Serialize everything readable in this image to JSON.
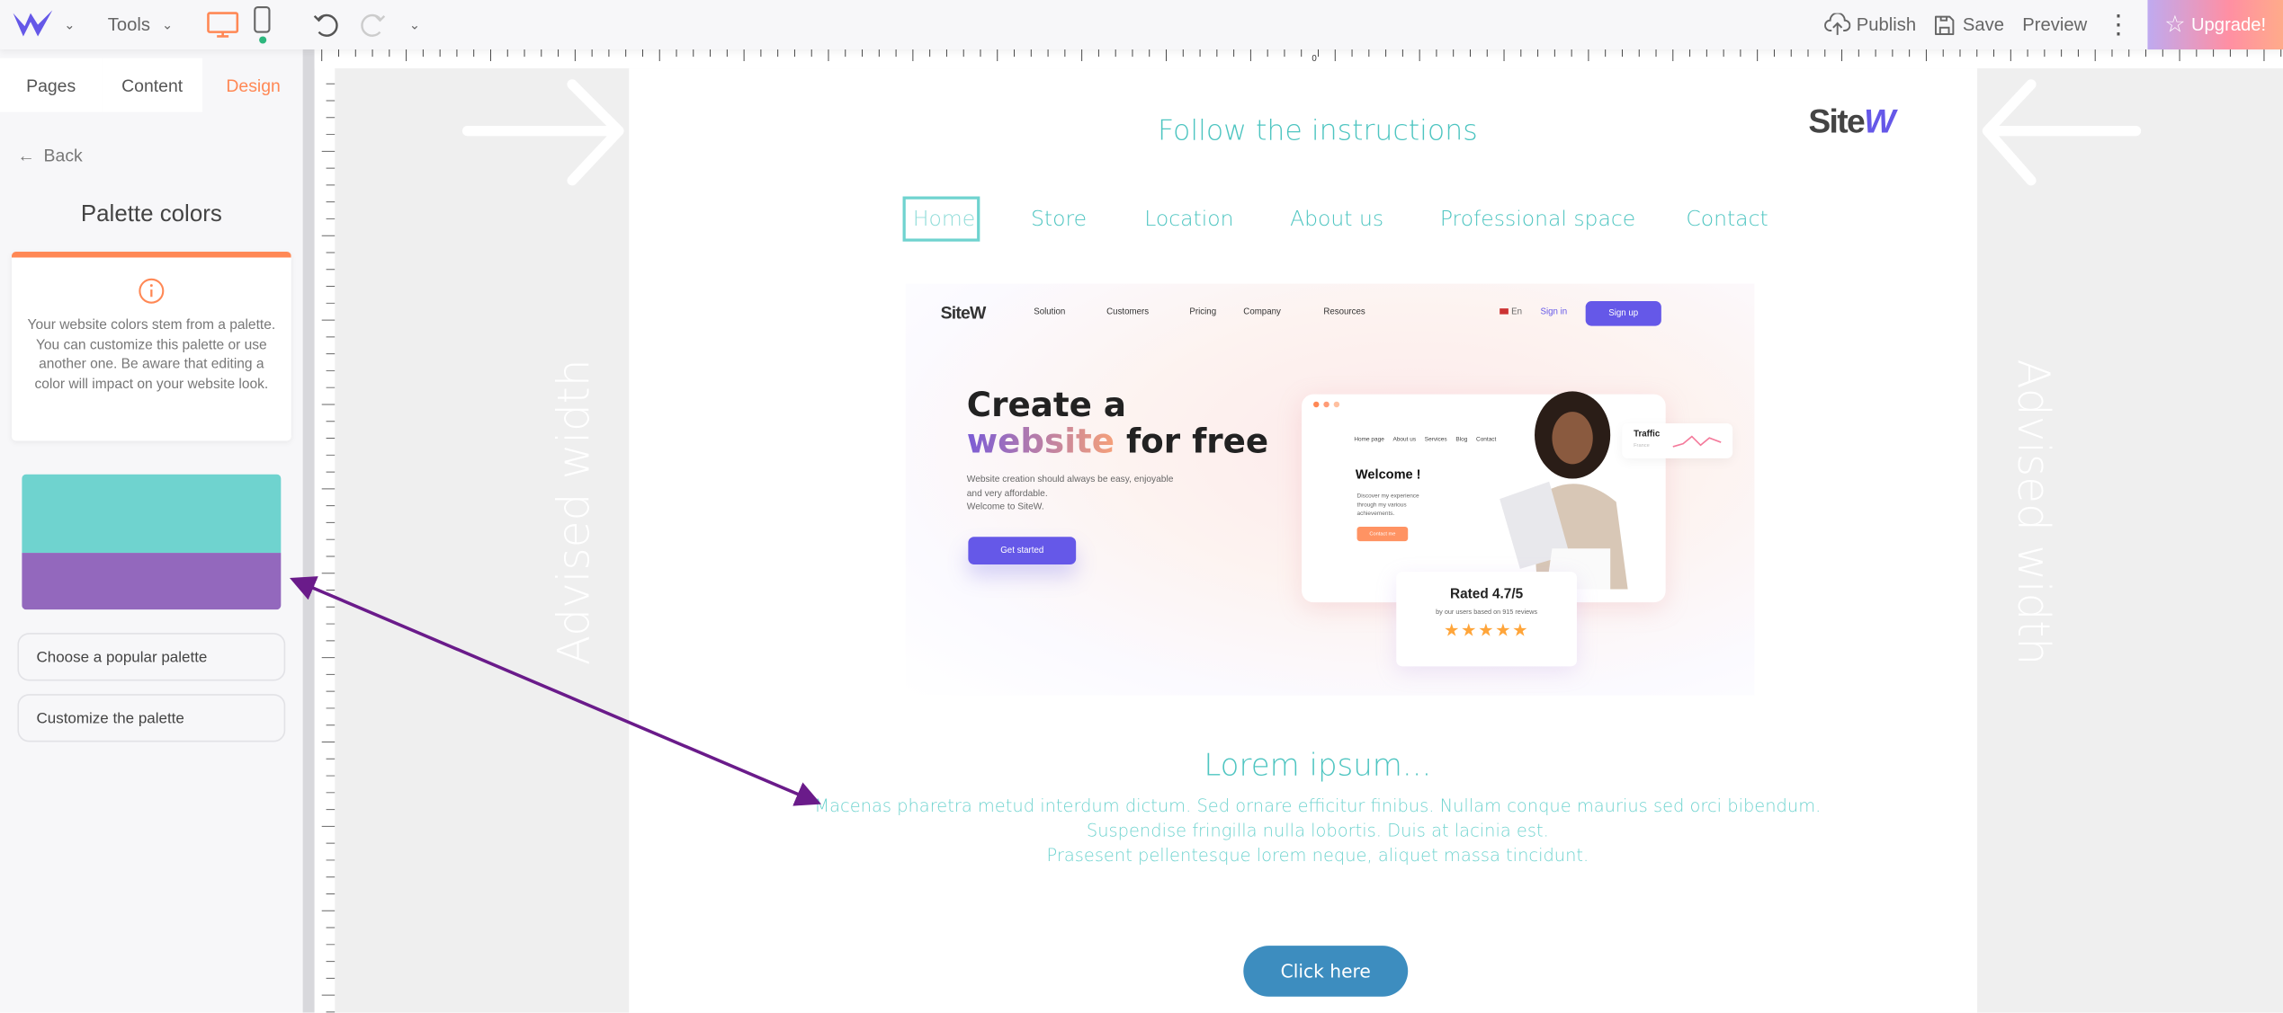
{
  "topbar": {
    "tools": "Tools",
    "publish": "Publish",
    "save": "Save",
    "preview": "Preview",
    "upgrade": "Upgrade!"
  },
  "sidebar": {
    "tabs": [
      "Pages",
      "Content",
      "Design"
    ],
    "back": "Back",
    "title": "Palette colors",
    "info": "Your website colors stem from a palette. You can customize this palette or use another one. Be aware that editing a color will impact on your website look.",
    "palette": [
      "#6fd3cf",
      "#9368bd"
    ],
    "buttons": [
      "Choose a popular palette",
      "Customize the palette"
    ]
  },
  "canvas": {
    "advised_left": "Advised width",
    "advised_right": "Advised width",
    "ruler_zero": "0"
  },
  "page": {
    "title": "Follow the instructions",
    "logo": "SiteW",
    "nav": [
      "Home",
      "Store",
      "Location",
      "About us",
      "Professional space",
      "Contact"
    ],
    "hero": {
      "logo": "SiteW",
      "nav": [
        "Solution",
        "Customers",
        "Pricing",
        "Company",
        "Resources"
      ],
      "lang": "En",
      "signin": "Sign in",
      "signup": "Sign up",
      "headline1": "Create a",
      "headline_accent": "website",
      "headline2": " for free",
      "desc": [
        "Website creation should always be easy, enjoyable",
        "and very affordable.",
        "Welcome to SiteW."
      ],
      "cta": "Get started",
      "mock_nav": [
        "Home page",
        "About us",
        "Services",
        "Blog",
        "Contact"
      ],
      "welcome": "Welcome !",
      "welcome_desc": [
        "Discover my experience",
        "through my various",
        "achievements."
      ],
      "contact": "Contact me",
      "traffic": "Traffic",
      "traffic_sub": "France",
      "rated": "Rated 4.7/5",
      "rated_sub": "by our users based on 915 reviews",
      "stars": 5
    },
    "section_title": "Lorem ipsum...",
    "paragraph": [
      "Macenas pharetra metud interdum dictum. Sed ornare efficitur finibus. Nullam conque maurius sed orci bibendum.",
      "Suspendise fringilla nulla lobortis. Duis at lacinia est.",
      "Prasesent pellentesque lorem neque, aliquet massa tincidunt."
    ],
    "button": "Click here"
  },
  "colors": {
    "accent": "#ff8855",
    "teal": "#4ec5c1",
    "brand": "#6558e8",
    "button": "#3d8dbf",
    "arrow": "#6a1b8a"
  }
}
